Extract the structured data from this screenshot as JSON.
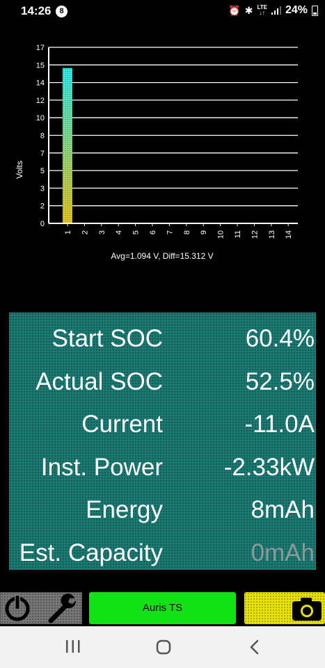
{
  "status_bar": {
    "time": "14:26",
    "notification_badge": "8",
    "network": "LTE",
    "battery": "24%"
  },
  "chart_data": {
    "type": "bar",
    "categories": [
      "1",
      "2",
      "3",
      "4",
      "5",
      "6",
      "7",
      "8",
      "9",
      "10",
      "11",
      "12",
      "13",
      "14"
    ],
    "values": [
      15.0,
      null,
      null,
      null,
      null,
      null,
      null,
      null,
      null,
      null,
      null,
      null,
      null,
      null
    ],
    "ylabel": "Volts",
    "xlabel": "Avg=1.094 V, Diff=15.312 V",
    "ylim": [
      0,
      17
    ],
    "yticks": [
      "0",
      "2",
      "3",
      "5",
      "7",
      "8",
      "10",
      "12",
      "14",
      "15",
      "17"
    ],
    "grid": true,
    "bar_gradient": [
      "#e5c41a",
      "#2ee8e8"
    ]
  },
  "panel": {
    "rows": [
      {
        "label": "Start SOC",
        "value": "60.4%"
      },
      {
        "label": "Actual SOC",
        "value": "52.5%"
      },
      {
        "label": "Current",
        "value": "-11.0A"
      },
      {
        "label": "Inst. Power",
        "value": "-2.33kW"
      },
      {
        "label": "Energy",
        "value": "8mAh"
      },
      {
        "label": "Est. Capacity",
        "value": "0mAh"
      }
    ],
    "background": "#1c7a74"
  },
  "toolbar": {
    "device_name": "Auris TS",
    "icons": [
      "power-icon",
      "wrench-icon",
      "camera-icon"
    ],
    "colors": {
      "tools": "#777777",
      "device": "#12e212",
      "camera": "#e8e200"
    }
  },
  "navbar": {
    "icons": [
      "recent-apps-icon",
      "home-icon",
      "back-icon"
    ]
  }
}
